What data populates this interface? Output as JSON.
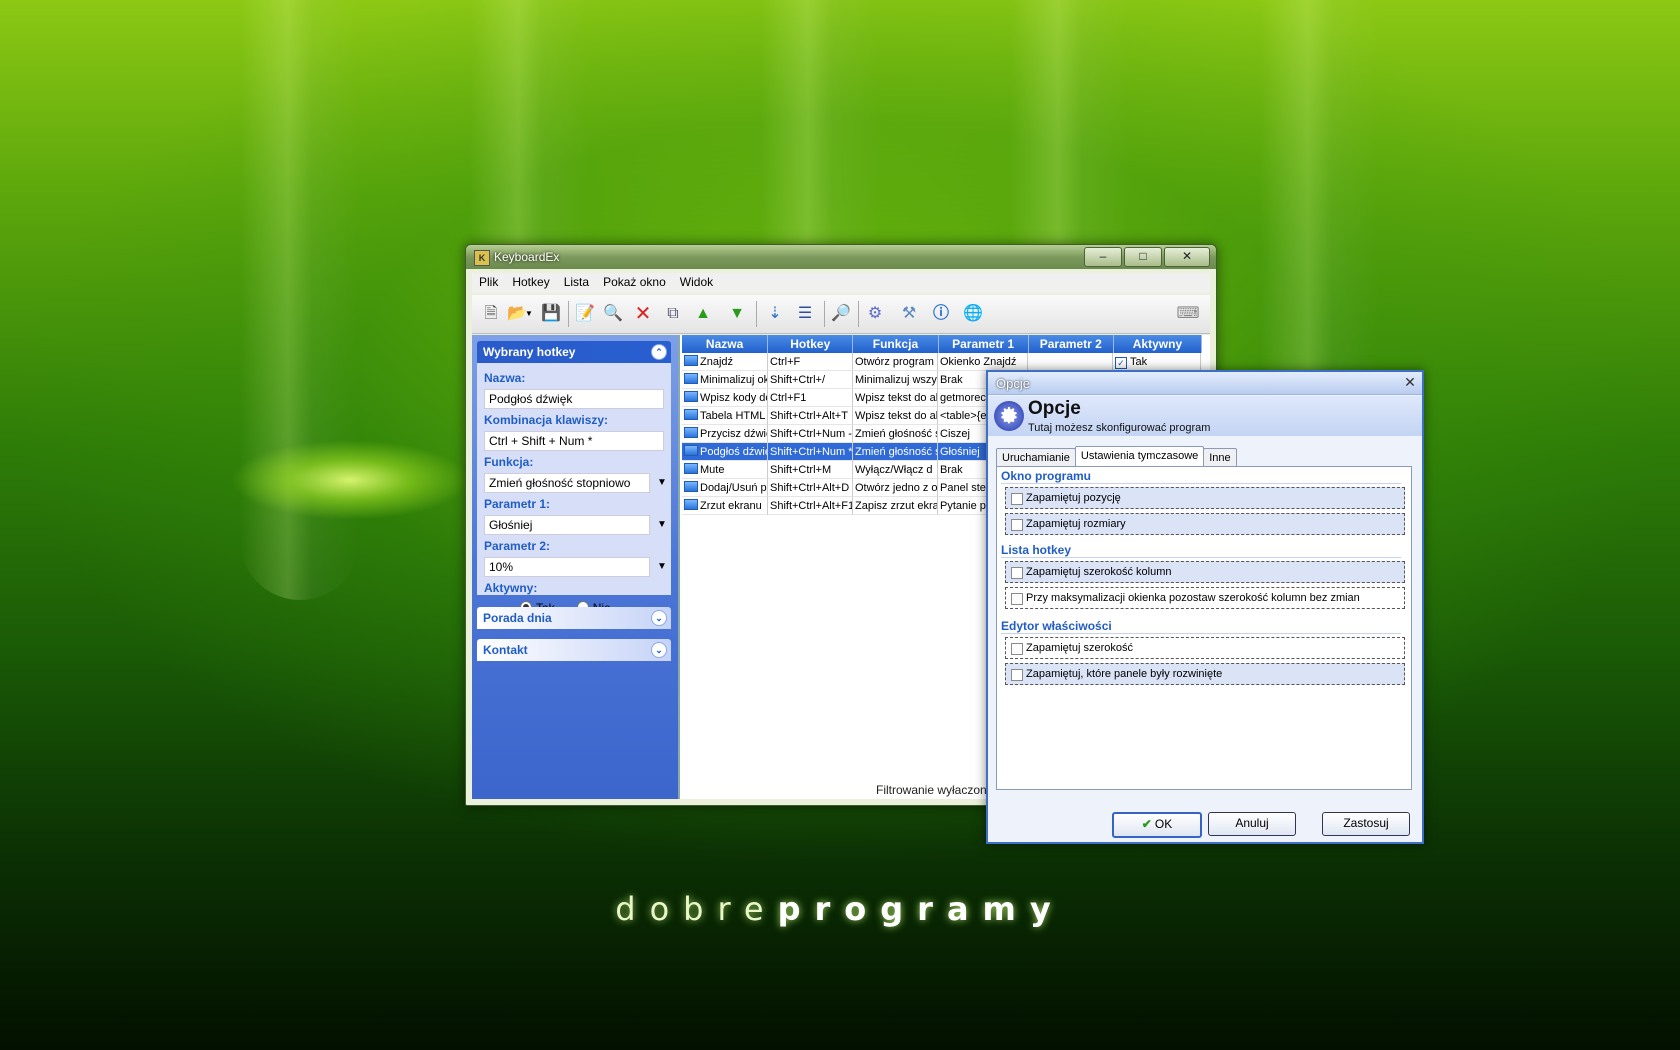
{
  "brand": {
    "part1": "dobre",
    "part2": "programy"
  },
  "window": {
    "title": "KeyboardEx",
    "app_icon": "K",
    "controls": {
      "minimize": "–",
      "maximize": "□",
      "close": "✕"
    }
  },
  "menu": [
    "Plik",
    "Hotkey",
    "Lista",
    "Pokaż okno",
    "Widok"
  ],
  "toolbar_icons": [
    "new-icon",
    "open-icon",
    "save-icon",
    "save-as-icon",
    "preview-icon",
    "delete-icon",
    "copy-icon",
    "move-up-icon",
    "move-down-icon",
    "import-icon",
    "list-view-icon",
    "search-icon",
    "settings-icon",
    "tools-icon",
    "info-icon",
    "web-icon",
    "keyboard-icon"
  ],
  "sidebar": {
    "selected_title": "Wybrany hotkey",
    "name_label": "Nazwa:",
    "name_value": "Podgłoś dźwięk",
    "combo_label": "Kombinacja klawiszy:",
    "combo_value": "Ctrl + Shift + Num *",
    "function_label": "Funkcja:",
    "function_value": "Zmień głośność stopniowo",
    "param1_label": "Parametr 1:",
    "param1_value": "Głośniej",
    "param2_label": "Parametr 2:",
    "param2_value": "10%",
    "active_label": "Aktywny:",
    "active_yes": "Tak",
    "active_no": "Nie",
    "tip_title": "Porada dnia",
    "contact_title": "Kontakt"
  },
  "grid": {
    "columns": [
      "Nazwa",
      "Hotkey",
      "Funkcja",
      "Parametr 1",
      "Parametr 2",
      "Aktywny"
    ],
    "rows": [
      [
        "Znajdź",
        "Ctrl+F",
        "Otwórz program s",
        "Okienko Znajdź",
        "",
        "Tak"
      ],
      [
        "Minimalizuj okn",
        "Shift+Ctrl+/",
        "Minimalizuj wszyst",
        "Brak",
        "",
        ""
      ],
      [
        "Wpisz kody do",
        "Ctrl+F1",
        "Wpisz tekst do ak",
        "getmorec",
        "",
        ""
      ],
      [
        "Tabela HTML",
        "Shift+Ctrl+Alt+T",
        "Wpisz tekst do ak",
        "<table>{e",
        "",
        ""
      ],
      [
        "Przycisz dźwię",
        "Shift+Ctrl+Num -",
        "Zmień głośność s",
        "Ciszej",
        "",
        ""
      ],
      [
        "Podgłoś dźwię",
        "Shift+Ctrl+Num *",
        "Zmień głośność s",
        "Głośniej",
        "",
        ""
      ],
      [
        "Mute",
        "Shift+Ctrl+M",
        "Wyłącz/Włącz d",
        "Brak",
        "",
        ""
      ],
      [
        "Dodaj/Usuń p",
        "Shift+Ctrl+Alt+D",
        "Otwórz jedno z ok",
        "Panel ster",
        "",
        ""
      ],
      [
        "Zrzut ekranu",
        "Shift+Ctrl+Alt+F1",
        "Zapisz zrzut ekran",
        "Pytanie p",
        "",
        ""
      ]
    ],
    "selected_row": 5,
    "status": "Filtrowanie wyłaczone"
  },
  "dialog": {
    "title": "Opcje",
    "close": "✕",
    "header_title": "Opcje",
    "header_subtitle": "Tutaj możesz skonfigurować program",
    "tabs": [
      "Uruchamianie",
      "Ustawienia tymczasowe",
      "Inne"
    ],
    "active_tab": 1,
    "sections": [
      {
        "title": "Okno programu",
        "options": [
          "Zapamiętuj pozycję",
          "Zapamiętuj rozmiary"
        ]
      },
      {
        "title": "Lista hotkey",
        "options": [
          "Zapamiętuj szerokość kolumn",
          "Przy maksymalizacji okienka pozostaw szerokość kolumn bez zmian"
        ]
      },
      {
        "title": "Edytor właściwości",
        "options": [
          "Zapamiętuj szerokość",
          "Zapamiętuj, które panele były rozwinięte"
        ]
      }
    ],
    "buttons": {
      "ok": "OK",
      "cancel": "Anuluj",
      "apply": "Zastosuj"
    }
  }
}
